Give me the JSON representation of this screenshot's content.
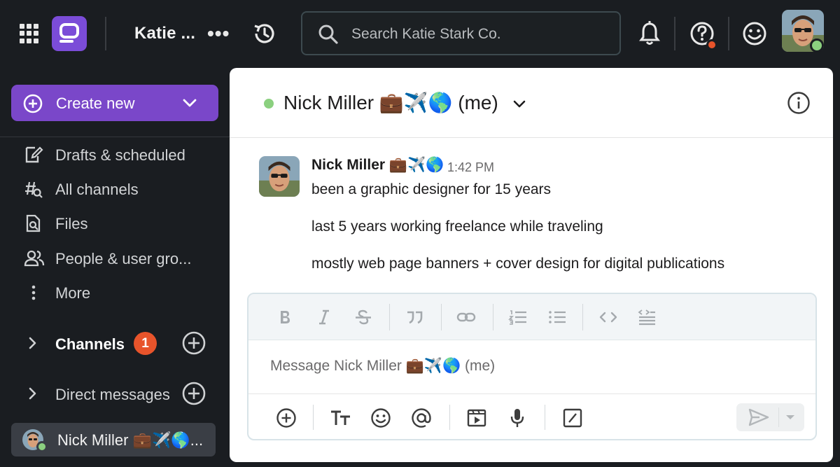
{
  "topbar": {
    "workspace_name": "Katie ...",
    "more_label": "•••",
    "search_placeholder": "Search Katie Stark Co."
  },
  "sidebar": {
    "create_label": "Create new",
    "nav": [
      {
        "label": "Drafts & scheduled",
        "icon": "drafts-icon"
      },
      {
        "label": "All channels",
        "icon": "channels-search-icon"
      },
      {
        "label": "Files",
        "icon": "files-icon"
      },
      {
        "label": "People & user gro...",
        "icon": "people-icon"
      },
      {
        "label": "More",
        "icon": "more-vertical-icon"
      }
    ],
    "channels_label": "Channels",
    "channels_badge": "1",
    "dms_label": "Direct messages",
    "self_dm_label": "Nick Miller 💼✈️🌎..."
  },
  "channel": {
    "title": "Nick Miller 💼✈️🌎 (me)"
  },
  "message": {
    "author": "Nick Miller 💼✈️🌎",
    "time": "1:42 PM",
    "lines": [
      "been a graphic designer for 15 years",
      "last 5 years working freelance while traveling",
      "mostly web page banners + cover design for digital publications"
    ]
  },
  "composer": {
    "placeholder": "Message Nick Miller 💼✈️🌎 (me)"
  },
  "colors": {
    "brand": "#7a47c9",
    "badge": "#e8542b",
    "presence": "#8bd07f",
    "sidebar_bg": "#1a1d21"
  }
}
